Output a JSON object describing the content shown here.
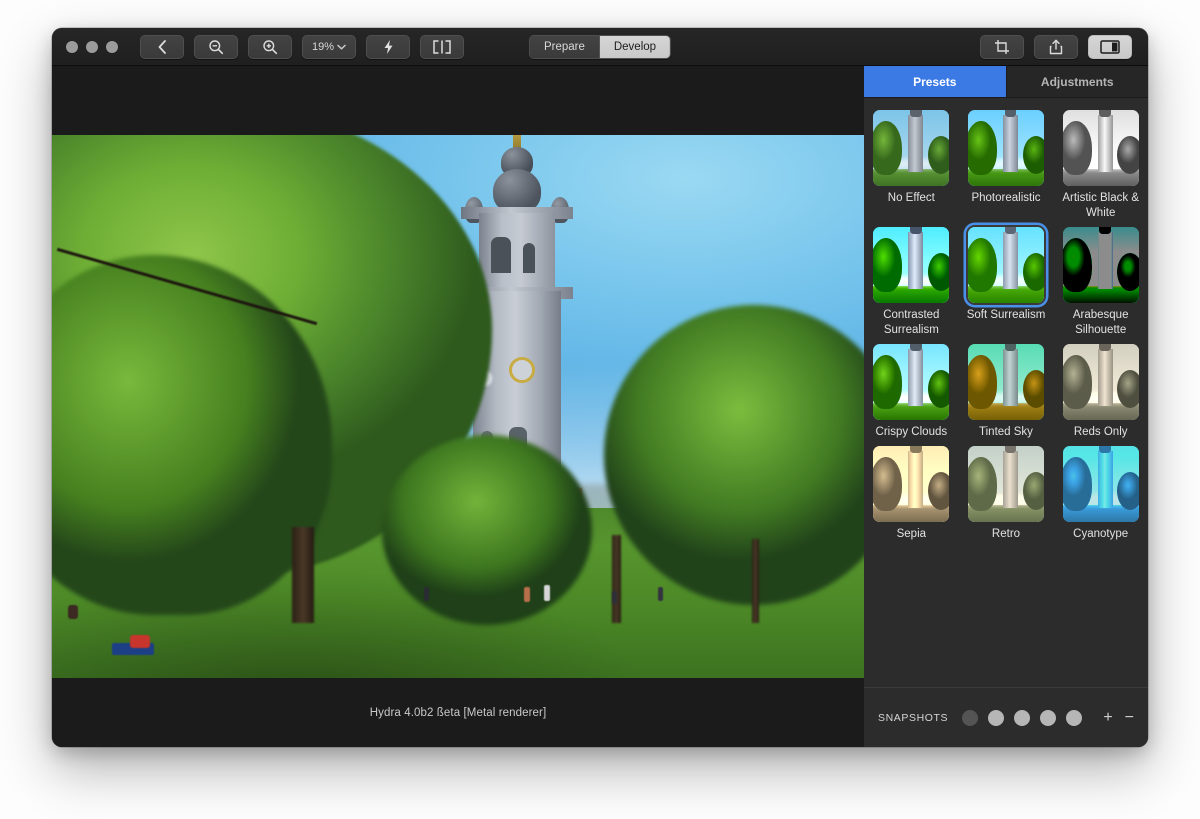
{
  "window": {
    "traffic_lights": [
      "close",
      "minimize",
      "zoom"
    ]
  },
  "toolbar": {
    "back_icon": "chevron-left-icon",
    "zoom_out_icon": "magnifier-minus-icon",
    "zoom_in_icon": "magnifier-plus-icon",
    "zoom_level": "19%",
    "zoom_chevron": "chevron-down-icon",
    "flash_icon": "lightning-bolt-icon",
    "compare_icon": "split-view-icon",
    "crop_icon": "crop-icon",
    "share_icon": "share-icon",
    "panel_icon": "right-panel-icon",
    "segments": [
      {
        "label": "Prepare",
        "active": false
      },
      {
        "label": "Develop",
        "active": true
      }
    ]
  },
  "canvas": {
    "status_text": "Hydra 4.0b2 ßeta [Metal renderer]"
  },
  "sidebar": {
    "tabs": [
      {
        "label": "Presets",
        "active": true
      },
      {
        "label": "Adjustments",
        "active": false
      }
    ],
    "presets": [
      {
        "label": "No Effect",
        "selected": false,
        "style": "none"
      },
      {
        "label": "Photorealistic",
        "selected": false,
        "style": "photoreal"
      },
      {
        "label": "Artistic Black & White",
        "selected": false,
        "style": "bw"
      },
      {
        "label": "Contrasted Surrealism",
        "selected": false,
        "style": "contrast"
      },
      {
        "label": "Soft Surrealism",
        "selected": true,
        "style": "soft"
      },
      {
        "label": "Arabesque Silhouette",
        "selected": false,
        "style": "silhouette"
      },
      {
        "label": "Crispy Clouds",
        "selected": false,
        "style": "crispy"
      },
      {
        "label": "Tinted Sky",
        "selected": false,
        "style": "tinted"
      },
      {
        "label": "Reds Only",
        "selected": false,
        "style": "reds"
      },
      {
        "label": "Sepia",
        "selected": false,
        "style": "sepia"
      },
      {
        "label": "Retro",
        "selected": false,
        "style": "retro"
      },
      {
        "label": "Cyanotype",
        "selected": false,
        "style": "cyan"
      }
    ],
    "snapshots": {
      "title": "SNAPSHOTS",
      "slots": [
        {
          "filled": false
        },
        {
          "filled": true
        },
        {
          "filled": true
        },
        {
          "filled": true
        },
        {
          "filled": true
        }
      ],
      "add_label": "+",
      "remove_label": "−"
    }
  },
  "colors": {
    "accent_blue": "#3b7ae5",
    "selection_ring": "#4a90e8",
    "window_bg": "#1d1d1d",
    "sidebar_bg": "#2c2c2c",
    "canvas_bg": "#1b1b1b"
  }
}
